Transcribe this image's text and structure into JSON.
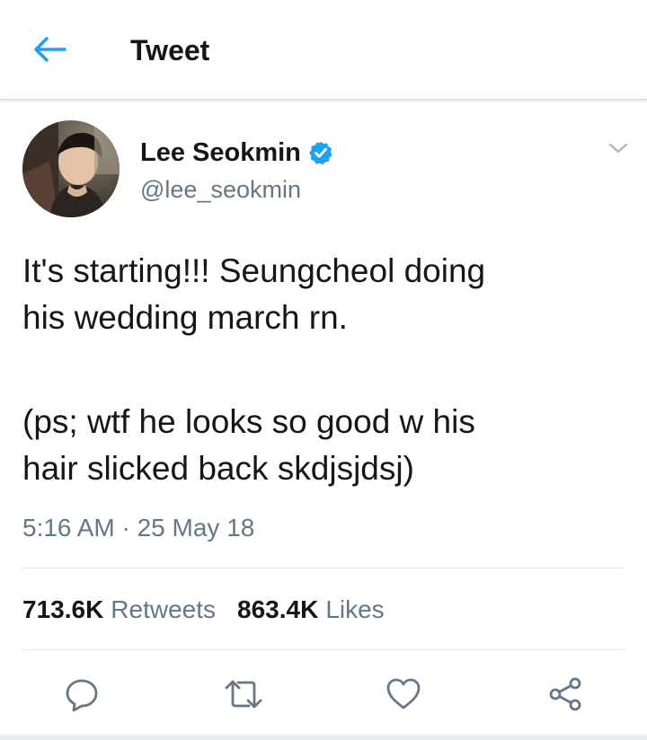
{
  "header": {
    "title": "Tweet",
    "back_icon": "arrow-left-icon"
  },
  "author": {
    "name": "Lee Seokmin",
    "handle": "@lee_seokmin",
    "verified": true,
    "verified_icon": "verified-badge-icon"
  },
  "tweet": {
    "line1": "It's starting!!! Seungcheol doing",
    "line2": "his wedding march rn.",
    "line3": "(ps; wtf he looks so good w his",
    "line4": "hair slicked back skdjsjdsj)",
    "timestamp": "5:16 AM · 25 May 18"
  },
  "stats": {
    "retweets_count": "713.6K",
    "retweets_label": "Retweets",
    "likes_count": "863.4K",
    "likes_label": "Likes"
  },
  "actions": {
    "reply_icon": "reply-icon",
    "retweet_icon": "retweet-icon",
    "like_icon": "heart-icon",
    "share_icon": "share-icon"
  },
  "colors": {
    "accent": "#1da1f2",
    "text": "#14171a",
    "secondary": "#657786"
  }
}
